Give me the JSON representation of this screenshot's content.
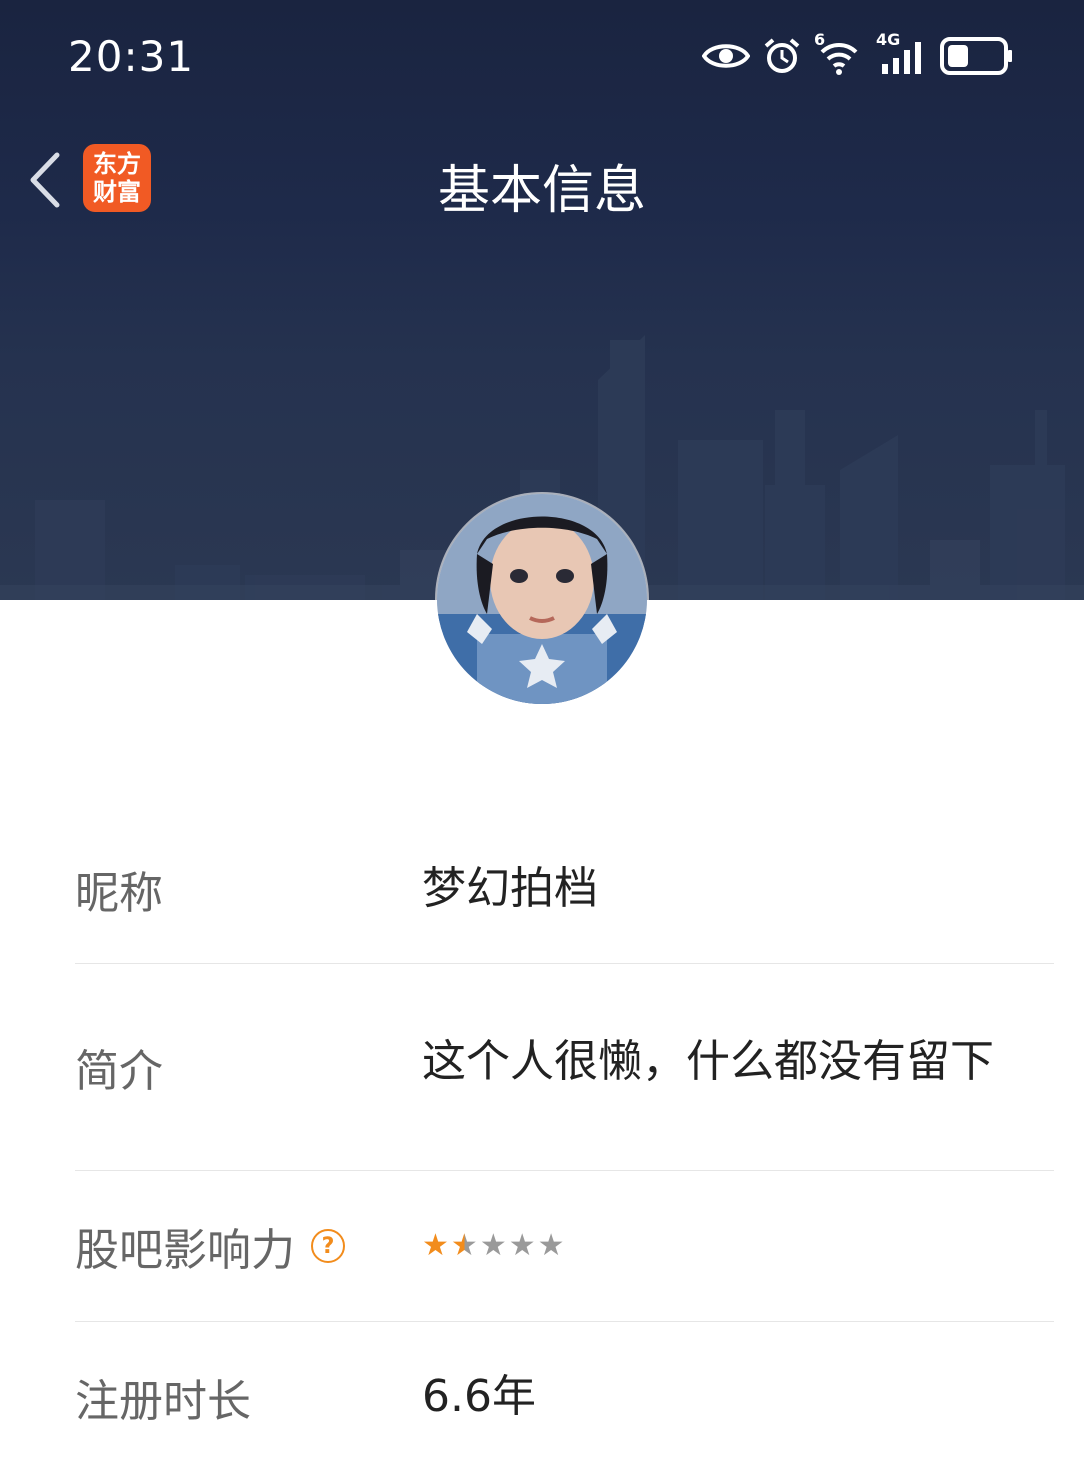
{
  "status_bar": {
    "time": "20:31",
    "icons": [
      "eye-icon",
      "alarm-icon",
      "wifi-icon",
      "cellular-4g-icon",
      "battery-icon"
    ],
    "wifi_badge": "6",
    "network_label": "4G"
  },
  "nav": {
    "back_icon": "chevron-left-icon",
    "logo_line1": "东方",
    "logo_line2": "财富",
    "title": "基本信息"
  },
  "colors": {
    "header_bg": "#1e2a4a",
    "accent": "#f28c1c",
    "logo_bg": "#f15a24"
  },
  "profile": {
    "rows": [
      {
        "label": "昵称",
        "value": "梦幻拍档"
      },
      {
        "label": "简介",
        "value": "这个人很懒，什么都没有留下"
      },
      {
        "label": "股吧影响力",
        "help": "?",
        "rating": 1.5,
        "rating_max": 5
      },
      {
        "label": "注册时长",
        "value": "6.6年"
      }
    ]
  }
}
